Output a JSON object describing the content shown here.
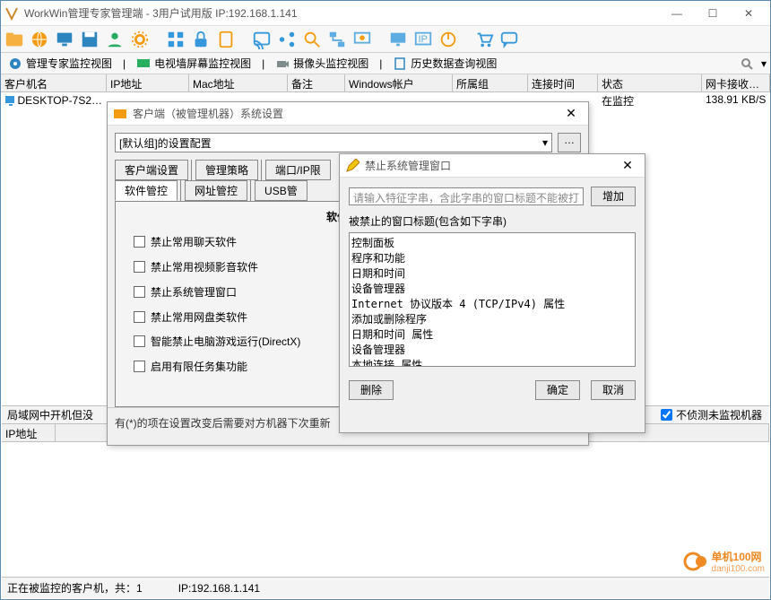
{
  "window": {
    "title": "WorkWin管理专家管理端 - 3用户试用版 IP:192.168.1.141"
  },
  "secondary_menu": {
    "items": [
      "管理专家监控视图",
      "电视墙屏幕监控视图",
      "摄像头监控视图",
      "历史数据查询视图"
    ]
  },
  "table": {
    "headers": [
      "客户机名",
      "IP地址",
      "Mac地址",
      "备注",
      "Windows帐户",
      "所属组",
      "连接时间",
      "状态",
      "网卡接收…"
    ],
    "row": {
      "name": "DESKTOP-7S2…",
      "status": "在监控",
      "rate": "138.91 KB/S"
    }
  },
  "lower": {
    "left_label": "局域网中开机但没",
    "right_check": "不侦测未监视机器",
    "header": "IP地址"
  },
  "status_bar": {
    "left": "正在被监控的客户机，共：1",
    "ip": "IP:192.168.1.141"
  },
  "logo": {
    "top": "单机100网",
    "bottom": "danji100.com"
  },
  "config_dialog": {
    "title": "客户端（被管理机器）系统设置",
    "combo": "[默认组]的设置配置",
    "tabs_row1": [
      "客户端设置",
      "管理策略",
      "端口/IP限"
    ],
    "tabs_row2": [
      "软件管控",
      "网址管控",
      "USB管"
    ],
    "section_title": "软件管控",
    "options": [
      "禁止常用聊天软件",
      "禁止常用视频影音软件",
      "禁止系统管理窗口",
      "禁止常用网盘类软件",
      "智能禁止电脑游戏运行(DirectX)",
      "启用有限任务集功能"
    ],
    "footnote": "有(*)的项在设置改变后需要对方机器下次重新"
  },
  "ban_dialog": {
    "title": "禁止系统管理窗口",
    "placeholder": "请输入特征字串，含此字串的窗口标题不能被打",
    "add": "增加",
    "list_label": "被禁止的窗口标题(包含如下字串)",
    "list_text": "控制面板\n程序和功能\n日期和时间\n设备管理器\nInternet 协议版本 4 (TCP/IPv4) 属性\n添加或删除程序\n日期和时间 属性\n设备管理器\n本地连接 属性\nInternet 协议 (TCP/IP) 属性",
    "delete": "删除",
    "ok": "确定",
    "cancel": "取消"
  }
}
